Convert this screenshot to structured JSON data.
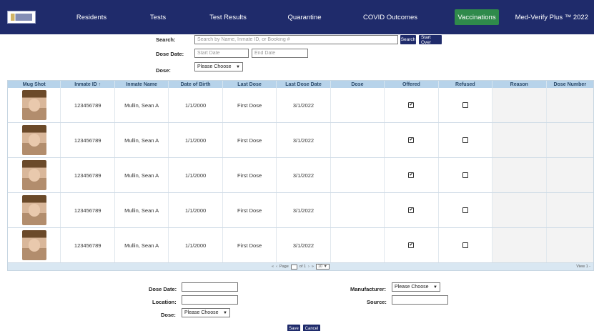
{
  "nav": {
    "items": [
      {
        "label": "Residents",
        "active": false
      },
      {
        "label": "Tests",
        "active": false
      },
      {
        "label": "Test Results",
        "active": false
      },
      {
        "label": "Quarantine",
        "active": false
      },
      {
        "label": "COVID Outcomes",
        "active": false
      },
      {
        "label": "Vaccinations",
        "active": true
      }
    ],
    "brand": "Med-Verify Plus ™ 2022",
    "accent": "#1f2b6b",
    "active_color": "#2f8a4b"
  },
  "search": {
    "search_label": "Search:",
    "search_placeholder": "Search by Name, Inmate ID, or Booking #",
    "search_button": "Search",
    "start_over_button": "Start Over",
    "dose_date_label": "Dose Date:",
    "start_date_placeholder": "Start Date",
    "end_date_placeholder": "End Date",
    "dose_label": "Dose:",
    "dose_selected": "Please Choose"
  },
  "table": {
    "columns": [
      "Mug Shot",
      "Inmate ID ↑",
      "Inmate Name",
      "Date of Birth",
      "Last Dose",
      "Last Dose Date",
      "Dose",
      "Offered",
      "Refused",
      "Reason",
      "Dose Number"
    ],
    "rows": [
      {
        "inmate_id": "123456789",
        "name": "Mullin, Sean A",
        "dob": "1/1/2000",
        "last_dose": "First Dose",
        "last_dose_date": "3/1/2022",
        "offered": true,
        "refused": false
      },
      {
        "inmate_id": "123456789",
        "name": "Mullin, Sean A",
        "dob": "1/1/2000",
        "last_dose": "First Dose",
        "last_dose_date": "3/1/2022",
        "offered": true,
        "refused": false
      },
      {
        "inmate_id": "123456789",
        "name": "Mullin, Sean A",
        "dob": "1/1/2000",
        "last_dose": "First Dose",
        "last_dose_date": "3/1/2022",
        "offered": true,
        "refused": false
      },
      {
        "inmate_id": "123456789",
        "name": "Mullin, Sean A",
        "dob": "1/1/2000",
        "last_dose": "First Dose",
        "last_dose_date": "3/1/2022",
        "offered": true,
        "refused": false
      },
      {
        "inmate_id": "123456789",
        "name": "Mullin, Sean A",
        "dob": "1/1/2000",
        "last_dose": "First Dose",
        "last_dose_date": "3/1/2022",
        "offered": true,
        "refused": false
      }
    ],
    "header_color": "#b7d3ea"
  },
  "pager": {
    "page_prefix": "Page",
    "page_suffix": "of 1",
    "page_size": "10",
    "view_text": "View 1 -"
  },
  "form": {
    "dose_date_label": "Dose Date:",
    "location_label": "Location:",
    "dose_label": "Dose:",
    "dose_selected": "Please Choose",
    "manufacturer_label": "Manufacturer:",
    "manufacturer_selected": "Please Choose",
    "source_label": "Source:",
    "save_button": "Save",
    "cancel_button": "Cancel"
  }
}
